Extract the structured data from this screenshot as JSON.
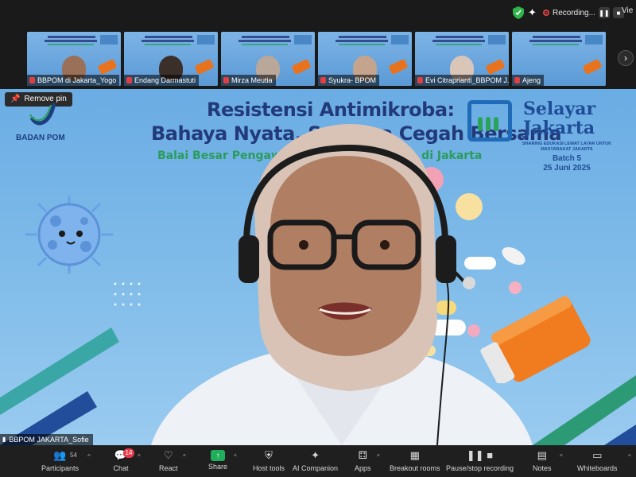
{
  "topbar": {
    "recording_label": "Recording...",
    "view_label": "Vie"
  },
  "thumbnails": [
    {
      "name": "BBPOM di Jakarta_Yogo"
    },
    {
      "name": "Endang Darmastuti"
    },
    {
      "name": "Mirza Meutia"
    },
    {
      "name": "Syukra- BPOM"
    },
    {
      "name": "Evi Citraprianti_BBPOM J..."
    },
    {
      "name": "Ajeng"
    }
  ],
  "main": {
    "remove_pin_label": "Remove pin",
    "logo_text": "BADAN POM",
    "title_line1": "Resistensi Antimikroba:",
    "title_line2": "Bahaya Nyata, Saatnya Cegah Bersama",
    "subtitle": "Balai Besar Pengawas Obat dan Makanan di Jakarta",
    "selayar_line1": "Selayar",
    "selayar_line2": "Jakarta",
    "selayar_tagline": "SHARING EDUKASI LEWAT LAYAR UNTUK MASYARAKAT JAKARTA",
    "batch": "Batch 5",
    "date": "25 Juni 2025",
    "speaker_name": "BBPOM JAKARTA_Sofie"
  },
  "toolbar": {
    "participants_label": "Participants",
    "participants_count": "54",
    "chat_label": "Chat",
    "chat_badge": "14",
    "react_label": "React",
    "share_label": "Share",
    "host_tools_label": "Host tools",
    "ai_companion_label": "AI Companion",
    "apps_label": "Apps",
    "breakout_label": "Breakout rooms",
    "pause_recording_label": "Pause/stop recording",
    "notes_label": "Notes",
    "whiteboards_label": "Whiteboards"
  },
  "colors": {
    "accent_green": "#2a9c5c",
    "title_navy": "#223a7a",
    "recording_red": "#e04040",
    "badge_red": "#e8394a"
  }
}
